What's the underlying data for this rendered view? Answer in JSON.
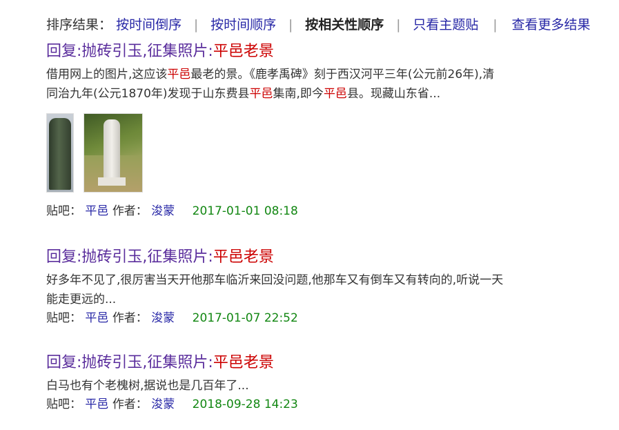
{
  "sort": {
    "label": "排序结果：",
    "options": [
      "按时间倒序",
      "按时间顺序",
      "按相关性顺序",
      "只看主题贴",
      "查看更多结果"
    ],
    "separator": "|"
  },
  "results": [
    {
      "title_prefix": "回复:抛砖引玉,征集照片:",
      "title_highlight": "平邑老景",
      "abstract_line1": [
        {
          "t": "借用网上的图片,这应该"
        },
        {
          "t": "平邑",
          "hl": true
        },
        {
          "t": "最老的景。《鹿孝禹碑》刻于西汉河平三年(公元前26年),清"
        }
      ],
      "abstract_line2": [
        {
          "t": "同治九年(公元1870年)发现于山东费县"
        },
        {
          "t": "平邑",
          "hl": true
        },
        {
          "t": "集南,即今"
        },
        {
          "t": "平邑",
          "hl": true
        },
        {
          "t": "县。现藏山东省..."
        }
      ],
      "meta_label_forum": "贴吧：",
      "forum": "平邑",
      "meta_label_author": "作者：",
      "author": "浚蒙",
      "date": "2017-01-01 08:18"
    },
    {
      "title_prefix": "回复:抛砖引玉,征集照片:",
      "title_highlight": "平邑老景",
      "abstract_line1": [
        {
          "t": "好多年不见了,很厉害当天开他那车临沂来回没问题,他那车又有倒车又有转向的,听说一天"
        }
      ],
      "abstract_line2": [
        {
          "t": "能走更远的..."
        }
      ],
      "meta_label_forum": "贴吧：",
      "forum": "平邑",
      "meta_label_author": "作者：",
      "author": "浚蒙",
      "date": "2017-01-07 22:52"
    },
    {
      "title_prefix": "回复:抛砖引玉,征集照片:",
      "title_highlight": "平邑老景",
      "abstract_line1": [
        {
          "t": "白马也有个老槐树,据说也是几百年了..."
        }
      ],
      "abstract_line2": [],
      "meta_label_forum": "贴吧：",
      "forum": "平邑",
      "meta_label_author": "作者：",
      "author": "浚蒙",
      "date": "2018-09-28 14:23"
    }
  ],
  "colors": {
    "link": "#2626a6",
    "title": "#5a2d9c",
    "highlight": "#cc0000",
    "date": "#128712"
  }
}
